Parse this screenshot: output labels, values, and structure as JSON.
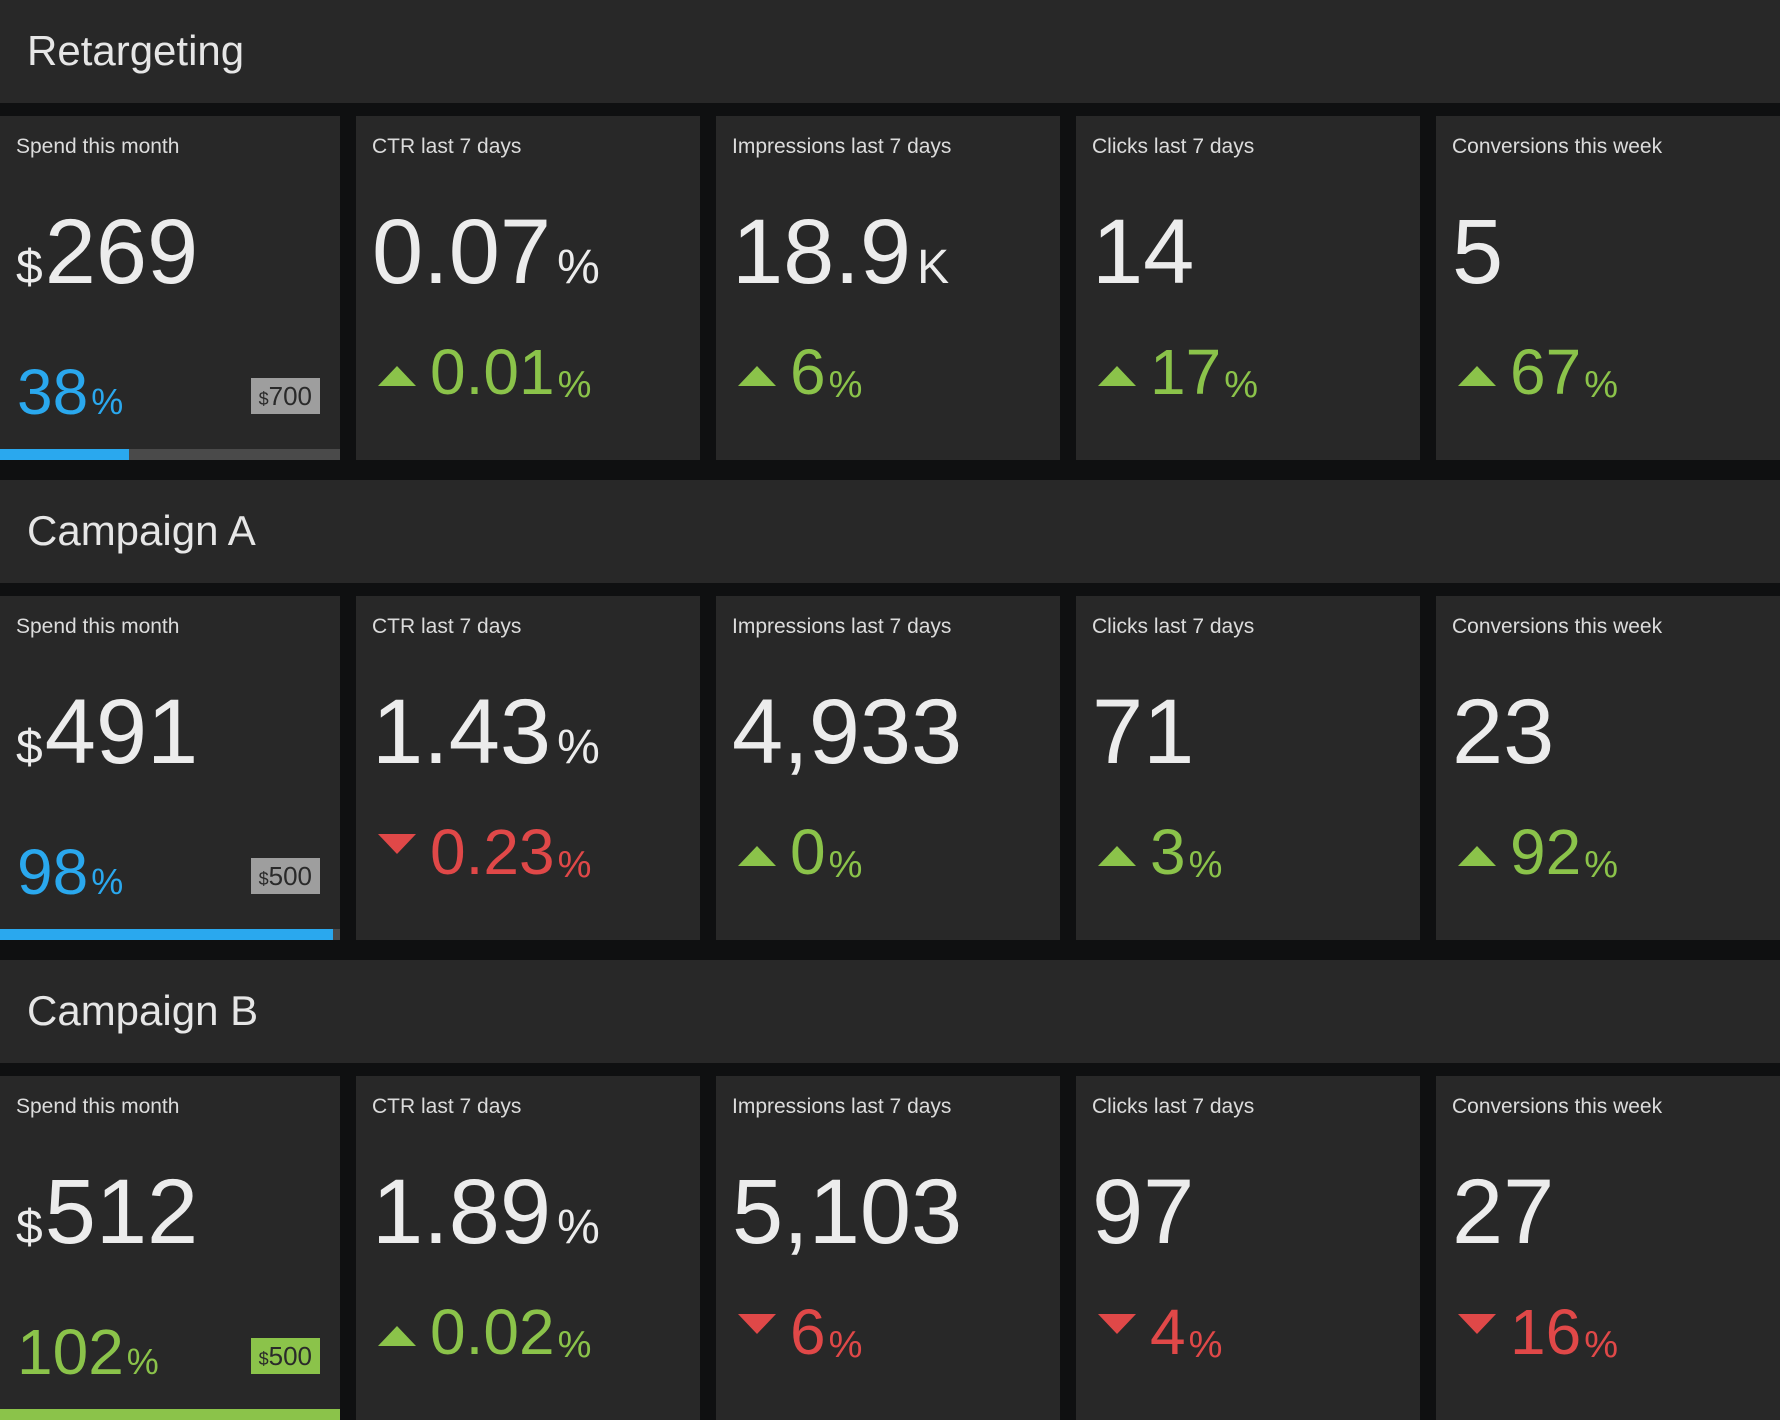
{
  "colors": {
    "background": "#0f1011",
    "panel": "#282828",
    "text": "#ececec",
    "label": "#dcdcdc",
    "blue": "#2aa8ee",
    "green": "#8bc34a",
    "red": "#e04848",
    "tag_gray": "#9e9e9e",
    "track": "#4a4a4a"
  },
  "sections": [
    {
      "title": "Retargeting",
      "spend": {
        "label": "Spend this month",
        "prefix": "$",
        "value": "269",
        "percent": "38",
        "percent_suffix": "%",
        "budget_currency": "$",
        "budget": "700",
        "progress": 0.38,
        "status": "under"
      },
      "metrics": [
        {
          "label": "CTR last 7 days",
          "value": "0.07",
          "suffix": "%",
          "direction": "up",
          "change": "0.01",
          "change_suffix": "%"
        },
        {
          "label": "Impressions last 7 days",
          "value": "18.9",
          "suffix": "K",
          "direction": "up",
          "change": "6",
          "change_suffix": "%"
        },
        {
          "label": "Clicks last 7 days",
          "value": "14",
          "suffix": "",
          "direction": "up",
          "change": "17",
          "change_suffix": "%"
        },
        {
          "label": "Conversions this week",
          "value": "5",
          "suffix": "",
          "direction": "up",
          "change": "67",
          "change_suffix": "%"
        }
      ]
    },
    {
      "title": "Campaign A",
      "spend": {
        "label": "Spend this month",
        "prefix": "$",
        "value": "491",
        "percent": "98",
        "percent_suffix": "%",
        "budget_currency": "$",
        "budget": "500",
        "progress": 0.98,
        "status": "under"
      },
      "metrics": [
        {
          "label": "CTR last 7 days",
          "value": "1.43",
          "suffix": "%",
          "direction": "down",
          "change": "0.23",
          "change_suffix": "%"
        },
        {
          "label": "Impressions last 7 days",
          "value": "4,933",
          "suffix": "",
          "direction": "up",
          "change": "0",
          "change_suffix": "%"
        },
        {
          "label": "Clicks last 7 days",
          "value": "71",
          "suffix": "",
          "direction": "up",
          "change": "3",
          "change_suffix": "%"
        },
        {
          "label": "Conversions this week",
          "value": "23",
          "suffix": "",
          "direction": "up",
          "change": "92",
          "change_suffix": "%"
        }
      ]
    },
    {
      "title": "Campaign B",
      "spend": {
        "label": "Spend this month",
        "prefix": "$",
        "value": "512",
        "percent": "102",
        "percent_suffix": "%",
        "budget_currency": "$",
        "budget": "500",
        "progress": 1.0,
        "status": "over"
      },
      "metrics": [
        {
          "label": "CTR last 7 days",
          "value": "1.89",
          "suffix": "%",
          "direction": "up",
          "change": "0.02",
          "change_suffix": "%"
        },
        {
          "label": "Impressions last 7 days",
          "value": "5,103",
          "suffix": "",
          "direction": "down",
          "change": "6",
          "change_suffix": "%"
        },
        {
          "label": "Clicks last 7 days",
          "value": "97",
          "suffix": "",
          "direction": "down",
          "change": "4",
          "change_suffix": "%"
        },
        {
          "label": "Conversions this week",
          "value": "27",
          "suffix": "",
          "direction": "down",
          "change": "16",
          "change_suffix": "%"
        }
      ]
    }
  ]
}
